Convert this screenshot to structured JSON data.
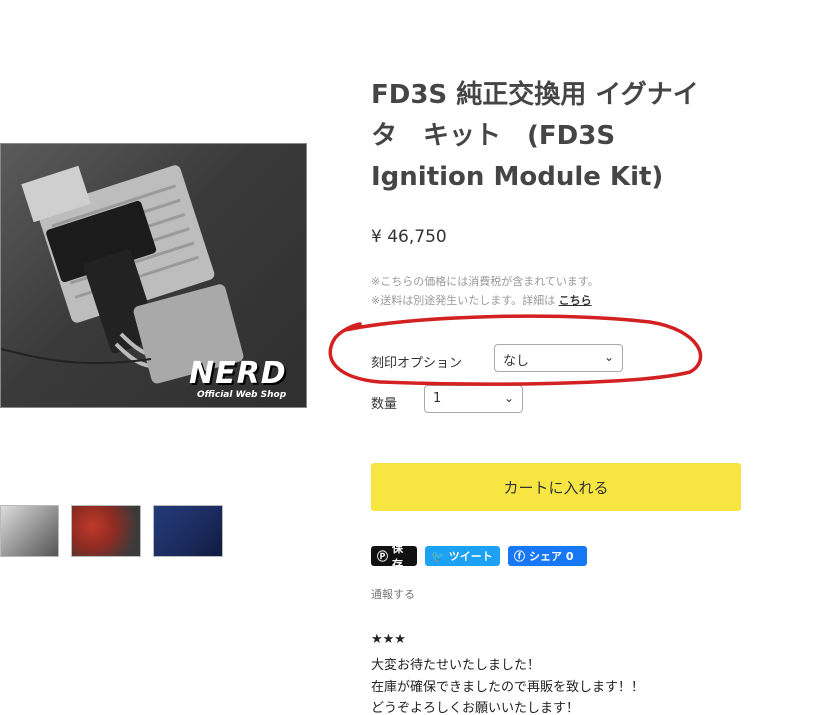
{
  "product": {
    "title_line1": "FD3S 純正交換用 イグナイ",
    "title_line2": "タ　キット　(FD3S",
    "title_line3": "Ignition Module Kit)",
    "price": "¥ 46,750",
    "tax_note": "※こちらの価格には消費税が含まれています。",
    "shipping_note": "※送料は別途発生いたします。詳細は",
    "shipping_link": "こちら"
  },
  "images": {
    "logo_text": "NERD",
    "logo_sub": "Official Web Shop"
  },
  "options": {
    "engraving_label": "刻印オプション",
    "engraving_value": "なし",
    "quantity_label": "数量",
    "quantity_value": "1"
  },
  "cart": {
    "add_to_cart_label": "カートに入れる"
  },
  "share": {
    "pinterest_label": "保存",
    "twitter_label": "ツイート",
    "facebook_label": "シェア 0"
  },
  "report_label": "通報する",
  "description": {
    "stars": "★★★",
    "line1": "大変お待たせいたしました！",
    "line2": "在庫が確保できましたので再販を致します！！",
    "line3": "どうぞよろしくお願いいたします！"
  },
  "colors": {
    "cart_button": "#f7e641",
    "annotation_circle": "#d32020",
    "twitter": "#1da1f2",
    "facebook": "#1877f2"
  }
}
